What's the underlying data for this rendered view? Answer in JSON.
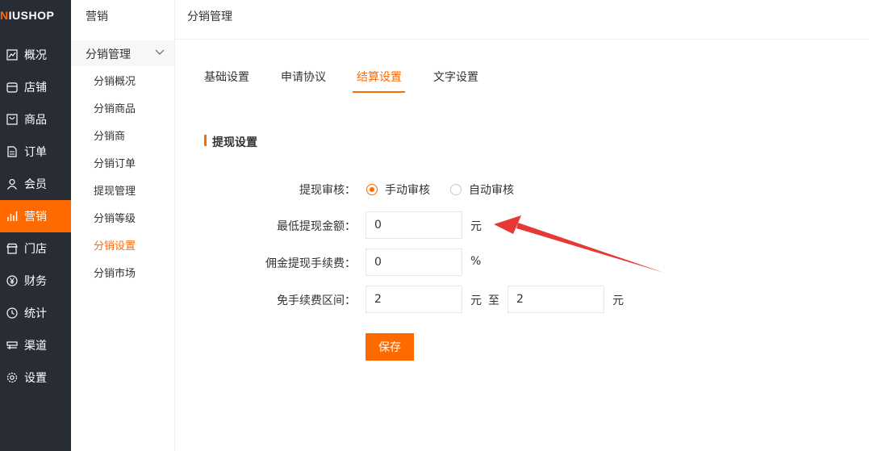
{
  "logo": {
    "prefix": "N",
    "rest": "IUSHOP"
  },
  "sidebar": {
    "items": [
      {
        "label": "概况",
        "icon": "chart-line-icon"
      },
      {
        "label": "店铺",
        "icon": "store-icon"
      },
      {
        "label": "商品",
        "icon": "bag-icon"
      },
      {
        "label": "订单",
        "icon": "document-icon"
      },
      {
        "label": "会员",
        "icon": "user-icon"
      },
      {
        "label": "营销",
        "icon": "bar-chart-icon",
        "active": true
      },
      {
        "label": "门店",
        "icon": "shop-icon"
      },
      {
        "label": "财务",
        "icon": "yen-icon"
      },
      {
        "label": "统计",
        "icon": "clock-icon"
      },
      {
        "label": "渠道",
        "icon": "channel-icon"
      },
      {
        "label": "设置",
        "icon": "gear-icon"
      }
    ]
  },
  "subnav": {
    "title": "营销",
    "group": "分销管理",
    "items": [
      "分销概况",
      "分销商品",
      "分销商",
      "分销订单",
      "提现管理",
      "分销等级",
      "分销设置",
      "分销市场"
    ],
    "active_index": 6
  },
  "header": {
    "title": "分销管理"
  },
  "tabs": [
    {
      "label": "基础设置"
    },
    {
      "label": "申请协议"
    },
    {
      "label": "结算设置",
      "active": true
    },
    {
      "label": "文字设置"
    }
  ],
  "section": {
    "title": "提现设置"
  },
  "form": {
    "review": {
      "label": "提现审核：",
      "options": [
        "手动审核",
        "自动审核"
      ],
      "selected": "手动审核"
    },
    "min_amount": {
      "label": "最低提现金额：",
      "value": "0",
      "unit": "元"
    },
    "fee": {
      "label": "佣金提现手续费：",
      "value": "0",
      "unit": "%"
    },
    "free_range": {
      "label": "免手续费区间：",
      "from": "2",
      "to": "2",
      "unit_from": "元",
      "sep": "至",
      "unit_to": "元"
    },
    "save_label": "保存"
  },
  "colors": {
    "accent": "#ff6a00",
    "sidebar_bg": "#282c35",
    "arrow": "#e53935"
  }
}
